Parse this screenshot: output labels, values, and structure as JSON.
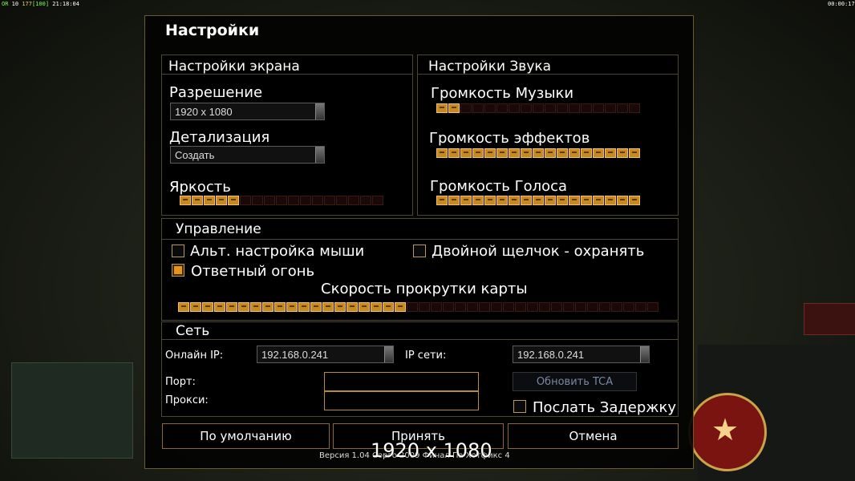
{
  "hud": {
    "left_1": "OR",
    "left_2": "10",
    "left_3": "177",
    "left_4": "[100]",
    "left_time": "21:18:04",
    "right_time": "00:00:17"
  },
  "dialog": {
    "title": "Настройки"
  },
  "screen": {
    "title": "Настройки экрана",
    "resolution_label": "Разрешение",
    "resolution_value": "1920 x 1080",
    "detail_label": "Детализация",
    "detail_value": "Создать",
    "brightness_label": "Яркость",
    "brightness_level": 0.29
  },
  "sound": {
    "title": "Настройки Звука",
    "music_label": "Громкость Музыки",
    "music_level": 0.12,
    "effects_label": "Громкость эффектов",
    "effects_level": 1.0,
    "voice_label": "Громкость Голоса",
    "voice_level": 1.0
  },
  "controls": {
    "title": "Управление",
    "alt_mouse_label": "Альт. настройка мыши",
    "alt_mouse_checked": false,
    "double_click_label": "Двойной щелчок - охранять",
    "double_click_checked": false,
    "return_fire_label": "Ответный огонь",
    "return_fire_checked": true,
    "scroll_label": "Скорость прокрутки карты",
    "scroll_level": 0.47
  },
  "network": {
    "title": "Сеть",
    "online_ip_label": "Онлайн IP:",
    "online_ip_value": "192.168.0.241",
    "lan_ip_label": "IP сети:",
    "lan_ip_value": "192.168.0.241",
    "port_label": "Порт:",
    "port_value": "",
    "proxy_label": "Прокси:",
    "proxy_value": "",
    "refresh_tca_label": "Обновить TCA",
    "send_delay_label": "Послать Задержку",
    "send_delay_checked": false
  },
  "buttons": {
    "default": "По умолчанию",
    "accept": "Принять",
    "cancel": "Отмена"
  },
  "overlay_resolution": "1920 x 1080",
  "version": "Версия 1.04 Сорго 2009 Финал Па Хотфикс 4",
  "colors": {
    "accent": "#e6941c",
    "border_gold": "#b8912e",
    "panel_border": "#4c4632"
  }
}
